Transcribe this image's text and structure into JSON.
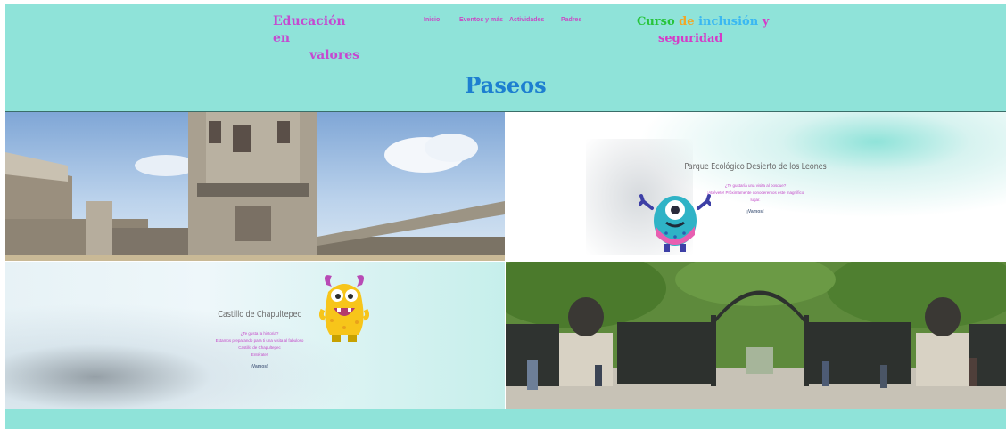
{
  "brand": {
    "line1": "Educación en",
    "line2": "valores"
  },
  "nav": {
    "items": [
      {
        "label": "Inicio"
      },
      {
        "label": "Eventos y más"
      },
      {
        "label": "Actividades"
      },
      {
        "label": "Padres"
      }
    ]
  },
  "course": {
    "w1": "Curso",
    "w2": "de",
    "w3": "inclusión",
    "w4": "y",
    "line2": "seguridad"
  },
  "page": {
    "title": "Paseos"
  },
  "cards": [
    {
      "title": "Parque  Ecológico Desierto de los Leones",
      "lines": [
        "¿Te gustaría una visita al bosque?",
        "¡Atrévete! Próximamente conoceremos este magnífico",
        "lugar."
      ],
      "cta": "¡Vamos!"
    },
    {
      "title": "Castillo de Chapultepec",
      "lines": [
        "¿Te gusta la historia?",
        "Estamos preparando para ti una visita al fabuloso",
        "Castillo de Chapultepec",
        "Entérate!"
      ],
      "cta": "¡Vamos!"
    }
  ],
  "colors": {
    "header_bg": "#8fe3d9",
    "brand": "#c44ad0",
    "title": "#1d7fd0",
    "monster_teal": "#2fb3c6",
    "monster_yellow": "#f7c51a"
  }
}
